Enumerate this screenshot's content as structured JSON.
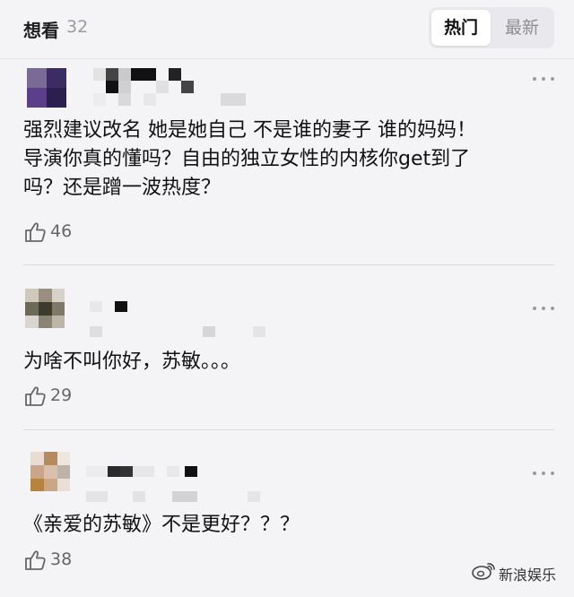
{
  "header": {
    "title": "想看",
    "count": "32",
    "tabs": [
      {
        "label": "热门",
        "active": true
      },
      {
        "label": "最新",
        "active": false
      }
    ]
  },
  "comments": [
    {
      "text_lines": [
        "强烈建议改名 她是她自己 不是谁的妻子 谁的妈妈！",
        "导演你真的懂吗？自由的独立女性的内核你get到了",
        "吗？还是蹭一波热度？"
      ],
      "likes": "46"
    },
    {
      "text_lines": [
        "为啥不叫你好，苏敏。。。"
      ],
      "likes": "29"
    },
    {
      "text_lines": [
        "《亲爱的苏敏》不是更好？？？"
      ],
      "likes": "38"
    }
  ],
  "watermark": {
    "text": "新浪娱乐",
    "icon": "weibo-icon"
  },
  "colors": {
    "background": "#f4f4f7",
    "muted_text": "#9a9aa0",
    "accent_tab_bg": "#ffffff"
  }
}
